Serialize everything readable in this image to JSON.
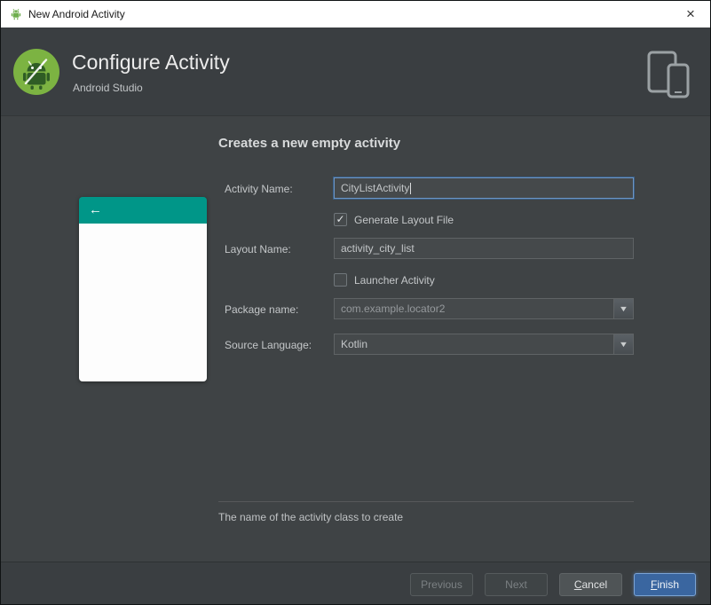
{
  "window": {
    "title": "New Android Activity"
  },
  "icons": {
    "close": "×",
    "back_arrow": "←",
    "dropdown_arrow": "▼",
    "check": "✓"
  },
  "header": {
    "title": "Configure Activity",
    "subtitle": "Android Studio"
  },
  "content": {
    "heading": "Creates a new empty activity",
    "fields": {
      "activity_name": {
        "label": "Activity Name:",
        "value": "CityListActivity",
        "focused": true
      },
      "generate_layout_file": {
        "label": "Generate Layout File",
        "checked": true
      },
      "layout_name": {
        "label": "Layout Name:",
        "value": "activity_city_list"
      },
      "launcher_activity": {
        "label": "Launcher Activity",
        "checked": false
      },
      "package_name": {
        "label": "Package name:",
        "value": "com.example.locator2"
      },
      "source_language": {
        "label": "Source Language:",
        "value": "Kotlin"
      }
    },
    "help_text": "The name of the activity class to create"
  },
  "footer": {
    "buttons": [
      {
        "label": "Previous",
        "enabled": false
      },
      {
        "label": "Next",
        "enabled": false
      },
      {
        "label": "Cancel",
        "enabled": true
      },
      {
        "label": "Finish",
        "enabled": true,
        "primary": true
      }
    ]
  },
  "colors": {
    "preview_appbar_teal": "#009688",
    "focus_border_blue": "#6d96c4",
    "finish_button_blue": "#3a66a0"
  }
}
